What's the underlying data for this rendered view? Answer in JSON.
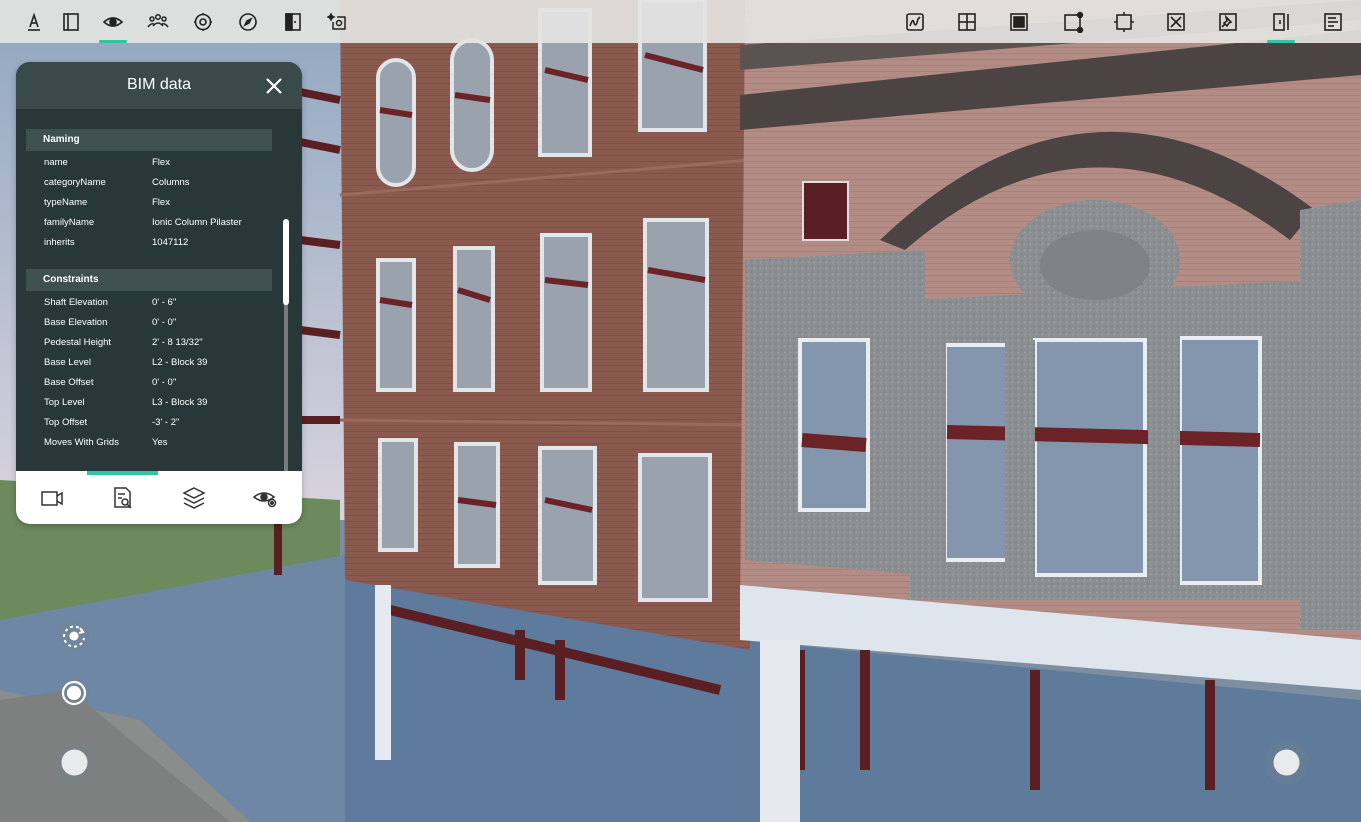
{
  "toolbar": {
    "left": [
      {
        "name": "measure-icon",
        "active": false
      },
      {
        "name": "section-box-icon",
        "active": false
      },
      {
        "name": "visibility-icon",
        "active": true
      },
      {
        "name": "people-icon",
        "active": false
      },
      {
        "name": "settings-icon",
        "active": false
      },
      {
        "name": "compass-icon",
        "active": false
      },
      {
        "name": "door-icon",
        "active": false
      },
      {
        "name": "focus-sparkle-icon",
        "active": false
      }
    ],
    "right": [
      {
        "name": "markup-icon",
        "active": false
      },
      {
        "name": "grid-icon",
        "active": false
      },
      {
        "name": "solid-square-icon",
        "active": false
      },
      {
        "name": "node-square-icon",
        "active": false
      },
      {
        "name": "fit-frame-icon",
        "active": false
      },
      {
        "name": "cross-box-icon",
        "active": false
      },
      {
        "name": "pin-icon",
        "active": false
      },
      {
        "name": "split-panel-icon",
        "active": true
      },
      {
        "name": "notes-icon",
        "active": false
      }
    ],
    "accent_color": "#2fc6a2"
  },
  "bim_panel": {
    "title": "BIM data",
    "sections": [
      {
        "heading": "Naming",
        "rows": [
          {
            "key": "name",
            "value": "Flex"
          },
          {
            "key": "categoryName",
            "value": "Columns"
          },
          {
            "key": "typeName",
            "value": "Flex"
          },
          {
            "key": "familyName",
            "value": "Ionic Column Pilaster"
          },
          {
            "key": "inherits",
            "value": "1047112"
          }
        ]
      },
      {
        "heading": "Constraints",
        "rows": [
          {
            "key": "Shaft Elevation",
            "value": "0' - 6\""
          },
          {
            "key": "Base Elevation",
            "value": "0' - 0\""
          },
          {
            "key": "Pedestal Height",
            "value": "2' - 8 13/32\""
          },
          {
            "key": "Base Level",
            "value": "L2 - Block 39"
          },
          {
            "key": "Base Offset",
            "value": "0' - 0\""
          },
          {
            "key": "Top Level",
            "value": "L3 - Block 39"
          },
          {
            "key": "Top Offset",
            "value": "-3' - 2\""
          },
          {
            "key": "Moves With Grids",
            "value": "Yes"
          }
        ]
      }
    ],
    "tabs": [
      {
        "name": "camera-tab-icon",
        "active": false
      },
      {
        "name": "document-search-tab-icon",
        "active": true
      },
      {
        "name": "layers-tab-icon",
        "active": false
      },
      {
        "name": "view-settings-tab-icon",
        "active": false
      }
    ]
  },
  "controls": [
    {
      "name": "rotate-mode-icon"
    },
    {
      "name": "target-mode-icon"
    },
    {
      "name": "move-joystick"
    },
    {
      "name": "look-joystick"
    }
  ]
}
